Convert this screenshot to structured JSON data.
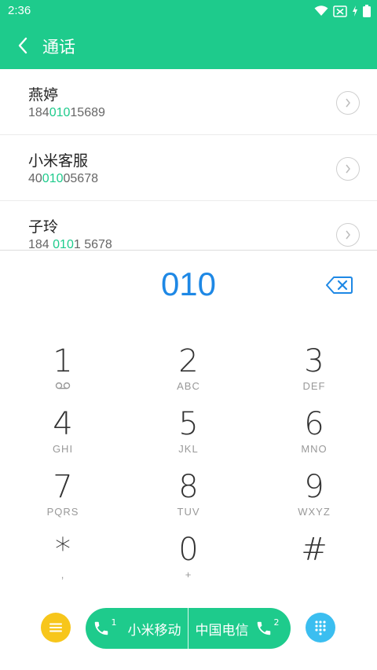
{
  "status_bar": {
    "time": "2:36",
    "icons": [
      "wifi-icon",
      "sim-no-signal-icon",
      "charging-icon",
      "battery-icon"
    ]
  },
  "app_bar": {
    "title": "通话",
    "back_icon": "chevron-left-icon"
  },
  "contacts": [
    {
      "name": "燕婷",
      "number_parts": [
        {
          "text": "184",
          "hl": false
        },
        {
          "text": "010",
          "hl": true
        },
        {
          "text": "15689",
          "hl": false
        }
      ]
    },
    {
      "name": "小米客服",
      "number_parts": [
        {
          "text": "40",
          "hl": false
        },
        {
          "text": "010",
          "hl": true
        },
        {
          "text": "05678",
          "hl": false
        }
      ]
    },
    {
      "name": "子玲",
      "number_parts": [
        {
          "text": "184 ",
          "hl": false
        },
        {
          "text": "010",
          "hl": true
        },
        {
          "text": "1 5678",
          "hl": false
        }
      ]
    }
  ],
  "dialer": {
    "display": "010"
  },
  "keypad": [
    {
      "digit": "1",
      "sub": "",
      "sub_icon": "voicemail-icon"
    },
    {
      "digit": "2",
      "sub": "ABC"
    },
    {
      "digit": "3",
      "sub": "DEF"
    },
    {
      "digit": "4",
      "sub": "GHI"
    },
    {
      "digit": "5",
      "sub": "JKL"
    },
    {
      "digit": "6",
      "sub": "MNO"
    },
    {
      "digit": "7",
      "sub": "PQRS"
    },
    {
      "digit": "8",
      "sub": "TUV"
    },
    {
      "digit": "9",
      "sub": "WXYZ"
    },
    {
      "digit": "*",
      "sub": ","
    },
    {
      "digit": "0",
      "sub": "+"
    },
    {
      "digit": "#",
      "sub": ""
    }
  ],
  "bottom_bar": {
    "sim1_label": "小米移动",
    "sim1_index": "1",
    "sim2_label": "中国电信",
    "sim2_index": "2"
  },
  "colors": {
    "primary": "#1ecb8c",
    "dial_text": "#1e88e5",
    "menu_button": "#f7c61b",
    "keypad_toggle": "#3bbef0"
  }
}
